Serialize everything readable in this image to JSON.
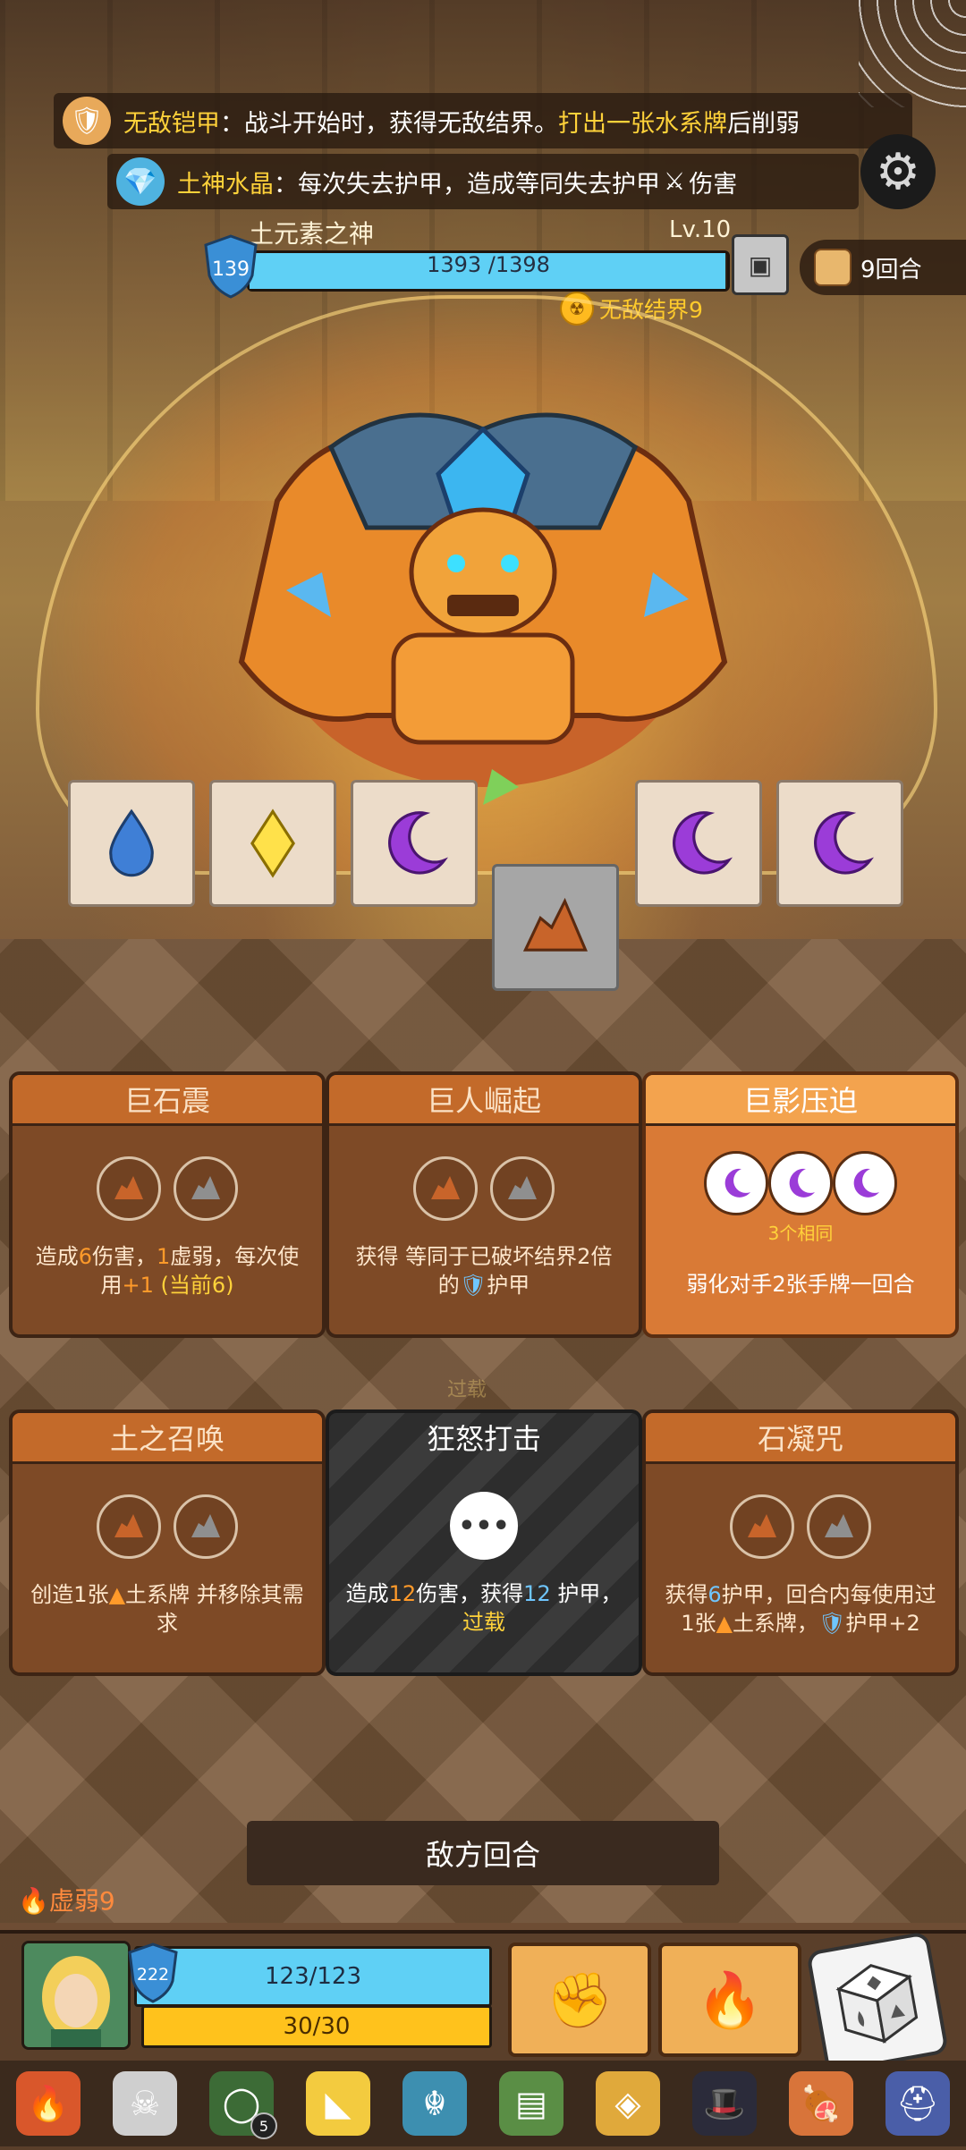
{
  "buffs": [
    {
      "icon": "armor-icon",
      "name": "无敌铠甲",
      "text_a": "：战斗开始时，获得无敌结界。",
      "highlight": "打出一张水系牌",
      "text_b": "后削弱"
    },
    {
      "icon": "crystal-icon",
      "name": "土神水晶",
      "text_a": "：每次失去护甲，造成等同失去护甲",
      "highlight": "",
      "text_b": "伤害"
    }
  ],
  "boss": {
    "name": "土元素之神",
    "level": "Lv.10",
    "shield": "139",
    "hp_text": "1393 /1398",
    "hp_fraction": 0.996,
    "invincible_label": "无敌结界9"
  },
  "round": "9回合",
  "dice_slots": [
    "water",
    "lightning",
    "moon",
    "moon",
    "moon"
  ],
  "center_die": "earth",
  "cards": [
    {
      "title": "巨石震",
      "desc_a": "造成",
      "num": "6",
      "desc_b": "伤害，",
      "num2": "1",
      "desc_c": "虚弱，每次使用",
      "num3": "+1",
      "desc_d": "(当前6)"
    },
    {
      "title": "巨人崛起",
      "desc": "获得 等同于已破坏结界2倍的",
      "desc_tail": "护甲"
    },
    {
      "title": "巨影压迫",
      "same_label": "3个相同",
      "desc": "弱化对手2张手牌一回合"
    },
    {
      "title": "土之召唤",
      "desc": "创造1张",
      "desc_tail": "土系牌 并移除其需求"
    },
    {
      "title": "狂怒打击",
      "desc_a": "造成",
      "num": "12",
      "desc_b": "伤害，获得",
      "num2": "12",
      "desc_c": "护甲，",
      "highlight": "过载"
    },
    {
      "title": "石凝咒",
      "desc_a": "获得",
      "num": "6",
      "desc_b": "护甲，回合内每使用过1张",
      "desc_c": "土系牌，",
      "desc_d": "护甲+2"
    }
  ],
  "overload_watermark": "过载",
  "enemy_turn_label": "敌方回合",
  "weak_status": "虚弱9",
  "player": {
    "shield": "222",
    "hp_text": "123/123",
    "energy_text": "30/30"
  },
  "relics": [
    {
      "icon": "fire-gauntlet-icon",
      "color": "#d9572b"
    },
    {
      "icon": "bull-skull-icon",
      "color": "#cfcfcf"
    },
    {
      "icon": "green-ring-icon",
      "color": "#3c6b36",
      "badge": "5"
    },
    {
      "icon": "cheese-icon",
      "color": "#f3cb3f"
    },
    {
      "icon": "demon-mask-icon",
      "color": "#3d8fb0"
    },
    {
      "icon": "green-tablet-icon",
      "color": "#5a8e45"
    },
    {
      "icon": "tribal-mask-icon",
      "color": "#e0a93b"
    },
    {
      "icon": "magic-hat-icon",
      "color": "#2b2b3a"
    },
    {
      "icon": "ham-icon",
      "color": "#d8743a"
    },
    {
      "icon": "viking-helmet-icon",
      "color": "#4a5ea8"
    }
  ]
}
